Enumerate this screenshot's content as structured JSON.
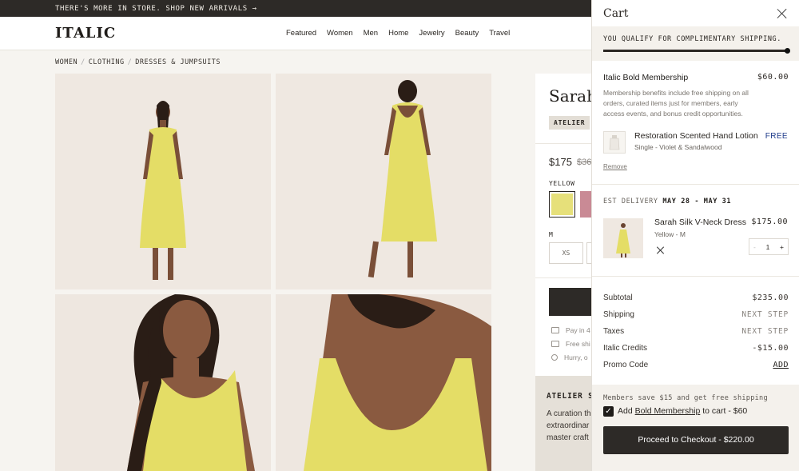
{
  "announcement": {
    "text": "THERE'S MORE IN STORE. SHOP NEW ARRIVALS →"
  },
  "header": {
    "logo": "ITALIC",
    "nav": [
      "Featured",
      "Women",
      "Men",
      "Home",
      "Jewelry",
      "Beauty",
      "Travel"
    ]
  },
  "breadcrumb": [
    "WOMEN",
    "CLOTHING",
    "DRESSES & JUMPSUITS"
  ],
  "product": {
    "title": "Sarah S",
    "badge": "ATELIER",
    "price": "$175",
    "compare_price": "$36",
    "color_label": "YELLOW",
    "size_label": "M",
    "size_option": "XS",
    "info": [
      "Pay in 4",
      "Free shi",
      "Hurry, o"
    ],
    "atelier_heading": "ATELIER SE",
    "atelier_text": [
      "A curation th",
      "extraordinar",
      "master craft"
    ]
  },
  "cart": {
    "title": "Cart",
    "shipping_message": "YOU QUALIFY FOR COMPLIMENTARY SHIPPING.",
    "shipping_progress": 1.0,
    "membership": {
      "name": "Italic Bold Membership",
      "price": "$60.00",
      "description": "Membership benefits include free shipping on all orders, curated items just for members, early access events, and bonus credit opportunities."
    },
    "gift": {
      "name": "Restoration Scented Hand Lotion",
      "variant": "Single - Violet & Sandalwood",
      "price": "FREE"
    },
    "remove_label": "Remove",
    "delivery": {
      "label": "EST DELIVERY",
      "dates": "MAY 28 - MAY 31"
    },
    "item": {
      "name": "Sarah Silk V-Neck Dress",
      "price": "$175.00",
      "variant": "Yellow - M",
      "qty": "1",
      "minus": "-",
      "plus": "+"
    },
    "summary": {
      "subtotal_label": "Subtotal",
      "subtotal": "$235.00",
      "shipping_label": "Shipping",
      "shipping": "NEXT STEP",
      "taxes_label": "Taxes",
      "taxes": "NEXT STEP",
      "credits_label": "Italic Credits",
      "credits": "-$15.00",
      "promo_label": "Promo Code",
      "promo_action": "ADD"
    },
    "members_save": "Members save $15 and get free shipping",
    "add_membership": {
      "prefix": "Add ",
      "link": "Bold Membership",
      "suffix": " to cart - $60",
      "checked": true
    },
    "checkout_label": "Proceed to Checkout - $220.00"
  },
  "colors": {
    "dark": "#2d2a27",
    "dress": "#e6e07a",
    "accent_blue": "#1e3b8a",
    "panel": "#f4f1ec"
  }
}
